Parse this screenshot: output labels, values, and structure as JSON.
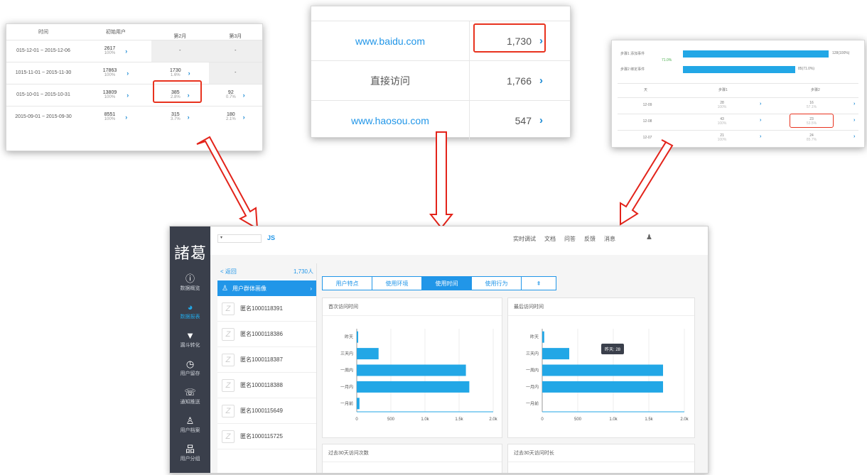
{
  "cohort": {
    "headers": {
      "time": "时间",
      "initial": "初始用户",
      "month2": "第2月",
      "month3": "第3月"
    },
    "rows": [
      {
        "range": "015-12-01 ~ 2015-12-06",
        "users": "2617",
        "pct": "100%",
        "m2": "-",
        "m2p": "",
        "m3": "-",
        "m3p": ""
      },
      {
        "range": "1015-11-01 ~ 2015-11-30",
        "users": "17863",
        "pct": "100%",
        "m2": "1730",
        "m2p": "1.6%",
        "m3": "-",
        "m3p": ""
      },
      {
        "range": "015-10-01 ~ 2015-10-31",
        "users": "13809",
        "pct": "100%",
        "m2": "385",
        "m2p": "2.8%",
        "m3": "92",
        "m3p": "0.7%"
      },
      {
        "range": "2015-09-01 ~ 2015-09-30",
        "users": "8551",
        "pct": "100%",
        "m2": "315",
        "m2p": "3.7%",
        "m3": "180",
        "m3p": "2.1%"
      }
    ]
  },
  "sources": [
    {
      "name": "www.baidu.com",
      "count": "1,730"
    },
    {
      "name": "直接访问",
      "count": "1,766"
    },
    {
      "name": "www.haosou.com",
      "count": "547"
    }
  ],
  "funnel": {
    "steps": [
      {
        "label": "步骤1 添加事件",
        "value": "128(100%)"
      },
      {
        "label": "步骤2 绑定事件",
        "value": "85(71.0%)"
      }
    ],
    "conversion": "71.0%",
    "headers": {
      "day": "天",
      "step1": "步骤1",
      "step2": "步骤2"
    },
    "rows": [
      {
        "day": "12-09",
        "s1": "28",
        "s1p": "100%",
        "s2": "16",
        "s2p": "57.1%"
      },
      {
        "day": "12-08",
        "s1": "43",
        "s1p": "100%",
        "s2": "23",
        "s2p": "53.5%"
      },
      {
        "day": "12-07",
        "s1": "21",
        "s1p": "100%",
        "s2": "24",
        "s2p": "85.7%"
      }
    ]
  },
  "app": {
    "logo": "諸葛",
    "project": "JS",
    "menu": [
      "实时调试",
      "文档",
      "问答",
      "反馈",
      "消息"
    ],
    "nav": [
      {
        "label": "数据概览",
        "icon": "ⓘ"
      },
      {
        "label": "数据报表",
        "icon": "◕"
      },
      {
        "label": "漏斗转化",
        "icon": "▼"
      },
      {
        "label": "用户留存",
        "icon": "◷"
      },
      {
        "label": "通知推送",
        "icon": "☏"
      },
      {
        "label": "用户档案",
        "icon": "♙"
      },
      {
        "label": "用户分组",
        "icon": "品"
      }
    ],
    "back": "< 返回",
    "count": "1,730人",
    "group": "用户群体画像",
    "users": [
      "匿名1000118391",
      "匿名1000118386",
      "匿名1000118387",
      "匿名1000118388",
      "匿名1000115649",
      "匿名1000115725"
    ],
    "tabs": [
      "用户特点",
      "使用环境",
      "使用时间",
      "使用行为",
      "⇞"
    ],
    "panel_titles": [
      "首次访问时间",
      "最后访问时间",
      "过去30天访问次数",
      "过去30天访问时长"
    ],
    "tooltip": "昨天: 28"
  },
  "chart_data": [
    {
      "type": "bar",
      "title": "首次访问时间",
      "categories": [
        "昨天",
        "三天内",
        "一周内",
        "一月内",
        "一月前"
      ],
      "values": [
        5,
        320,
        1600,
        1650,
        40
      ],
      "xlim": [
        0,
        2000
      ],
      "ticks": [
        "0",
        "500",
        "1.0k",
        "1.5k",
        "2.0k"
      ]
    },
    {
      "type": "bar",
      "title": "最后访问时间",
      "categories": [
        "昨天",
        "三天内",
        "一周内",
        "一月内",
        "一月前"
      ],
      "values": [
        28,
        380,
        1700,
        1700,
        0
      ],
      "xlim": [
        0,
        2000
      ],
      "ticks": [
        "0",
        "500",
        "1.0k",
        "1.5k",
        "2.0k"
      ]
    }
  ]
}
